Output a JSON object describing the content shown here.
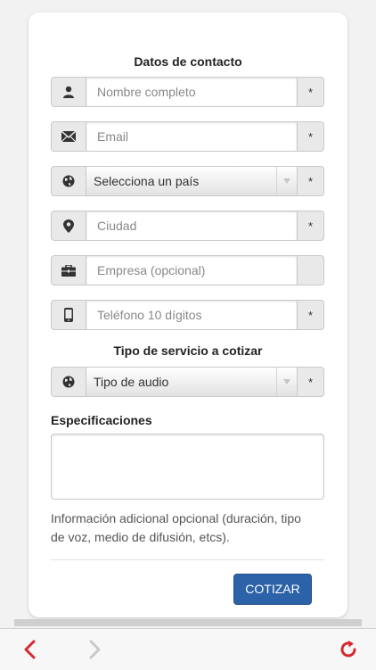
{
  "contact": {
    "title": "Datos de contacto",
    "name_placeholder": "Nombre completo",
    "email_placeholder": "Email",
    "country_selected": "Selecciona un país",
    "city_placeholder": "Ciudad",
    "company_placeholder": "Empresa (opcional)",
    "phone_placeholder": "Teléfono 10 dígitos",
    "required_mark": "*"
  },
  "service": {
    "title": "Tipo de servicio a cotizar",
    "audio_selected": "Tipo de audio"
  },
  "specs": {
    "label": "Especificaciones",
    "help": "Información adicional opcional (duración, tipo de voz, medio de difusión, etcs)."
  },
  "submit_label": "COTIZAR",
  "toolbar": {
    "back_icon": "chevron-left-icon",
    "forward_icon": "chevron-right-icon",
    "reload_icon": "reload-icon"
  },
  "colors": {
    "accent": "#2c62a8",
    "toolbar_icon": "#d7282f",
    "disabled_icon": "#c8c8c8"
  }
}
